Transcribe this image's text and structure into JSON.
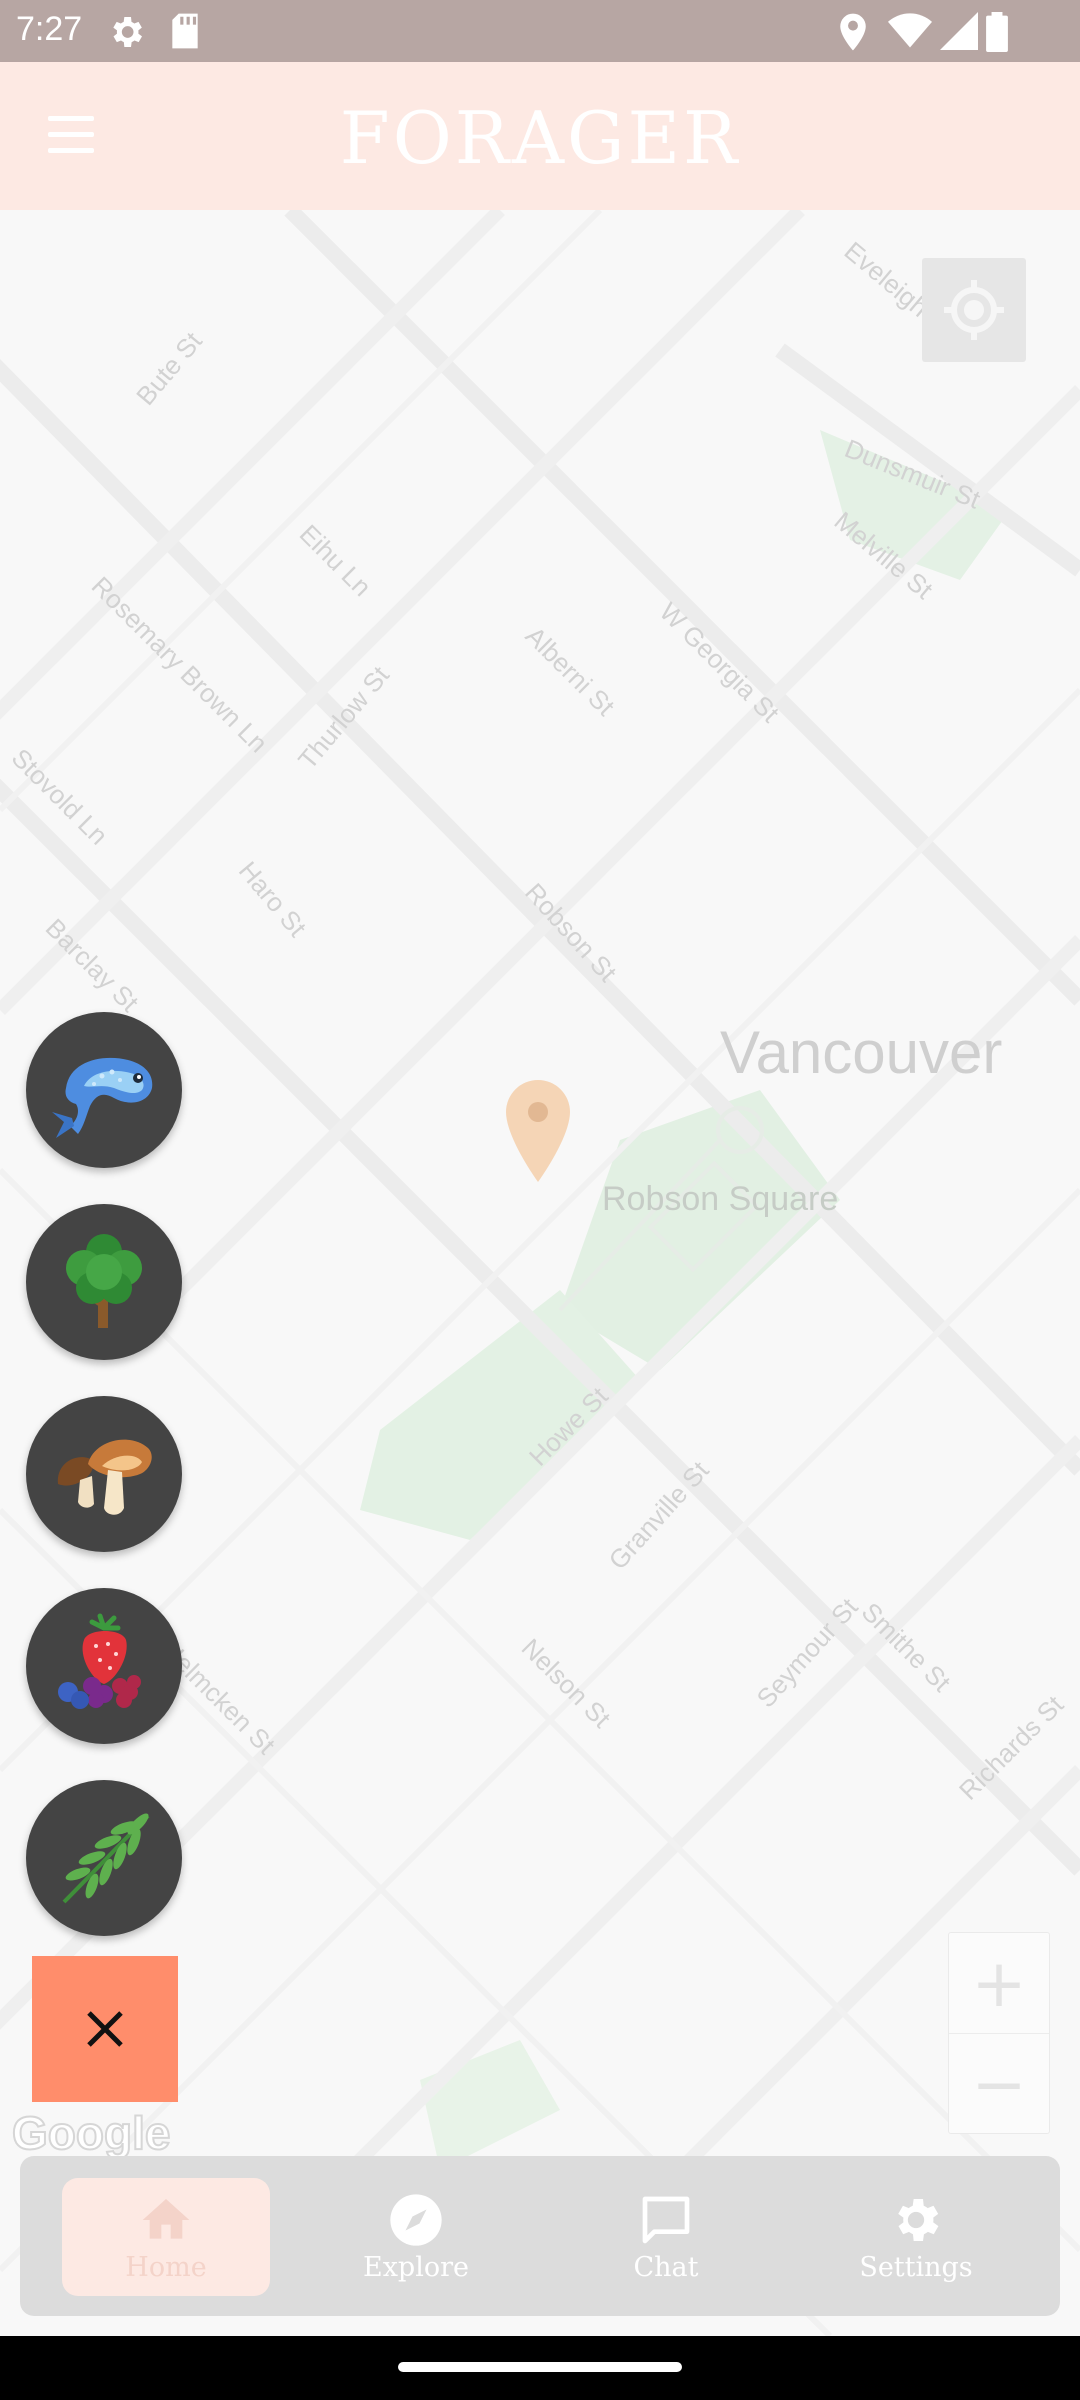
{
  "status_bar": {
    "time": "7:27",
    "icons": [
      "settings-icon",
      "sd-card-icon",
      "location-icon",
      "wifi-icon",
      "signal-icon",
      "battery-icon"
    ]
  },
  "app_bar": {
    "title": "FORAGER",
    "menu_icon": "hamburger-menu-icon"
  },
  "map": {
    "city_label": "Vancouver",
    "place_label": "Robson Square",
    "street_labels": [
      "Bute St",
      "Eveleigh",
      "Dunsmuir St",
      "Melville St",
      "Eihu Ln",
      "Rosemary Brown Ln",
      "Alberni St",
      "W Georgia St",
      "Thurlow St",
      "Stovold Ln",
      "Haro St",
      "Robson St",
      "Barclay St",
      "Howe St",
      "Granville St",
      "Smithe St",
      "Nelson St",
      "Seymour St",
      "Richards St",
      "Helmcken St"
    ],
    "zoom_in": "+",
    "zoom_out": "−",
    "attribution": "Google"
  },
  "categories": [
    {
      "name": "Fish",
      "icon": "fish-icon"
    },
    {
      "name": "Trees",
      "icon": "tree-icon"
    },
    {
      "name": "Mushrooms",
      "icon": "mushroom-icon"
    },
    {
      "name": "Berries",
      "icon": "berries-icon"
    },
    {
      "name": "Herbs",
      "icon": "herb-leaf-icon"
    }
  ],
  "close_fab": {
    "icon": "close-icon"
  },
  "bottom_nav": {
    "items": [
      {
        "label": "Home",
        "icon": "home-icon",
        "active": true
      },
      {
        "label": "Explore",
        "icon": "compass-icon",
        "active": false
      },
      {
        "label": "Chat",
        "icon": "chat-icon",
        "active": false
      },
      {
        "label": "Settings",
        "icon": "gear-icon",
        "active": false
      }
    ]
  },
  "colors": {
    "status_bar": "#b7a6a3",
    "app_bar": "#fde9e3",
    "fab_close": "#ff8d6b",
    "category_button": "#444444",
    "nav_bar": "#dcdcdc",
    "marker": "#f5d5b6"
  }
}
